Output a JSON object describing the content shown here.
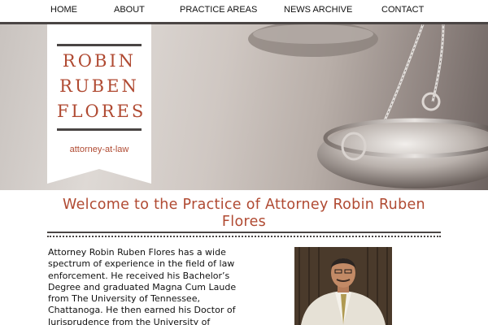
{
  "nav": {
    "items": [
      "HOME",
      "ABOUT",
      "PRACTICE AREAS",
      "NEWS ARCHIVE",
      "CONTACT"
    ]
  },
  "banner": {
    "name_lines": [
      "ROBIN",
      "RUBEN",
      "FLORES"
    ],
    "subtitle": "attorney-at-law"
  },
  "main": {
    "title": "Welcome to the Practice of Attorney Robin Ruben Flores",
    "body": "Attorney Robin Ruben Flores has a wide spectrum of experience in the field of law enforcement. He received his Bachelor’s Degree and graduated Magna Cum Laude from The University of Tennessee, Chattanoga. He then earned his Doctor of Jurisprudence from the University of Tennessee Knoxville College of Law. Bein"
  },
  "colors": {
    "accent": "#b04a32",
    "dark_rule": "#4a4544"
  },
  "icons": {
    "hero_image": "scales-of-justice",
    "portrait_image": "attorney-portrait"
  }
}
